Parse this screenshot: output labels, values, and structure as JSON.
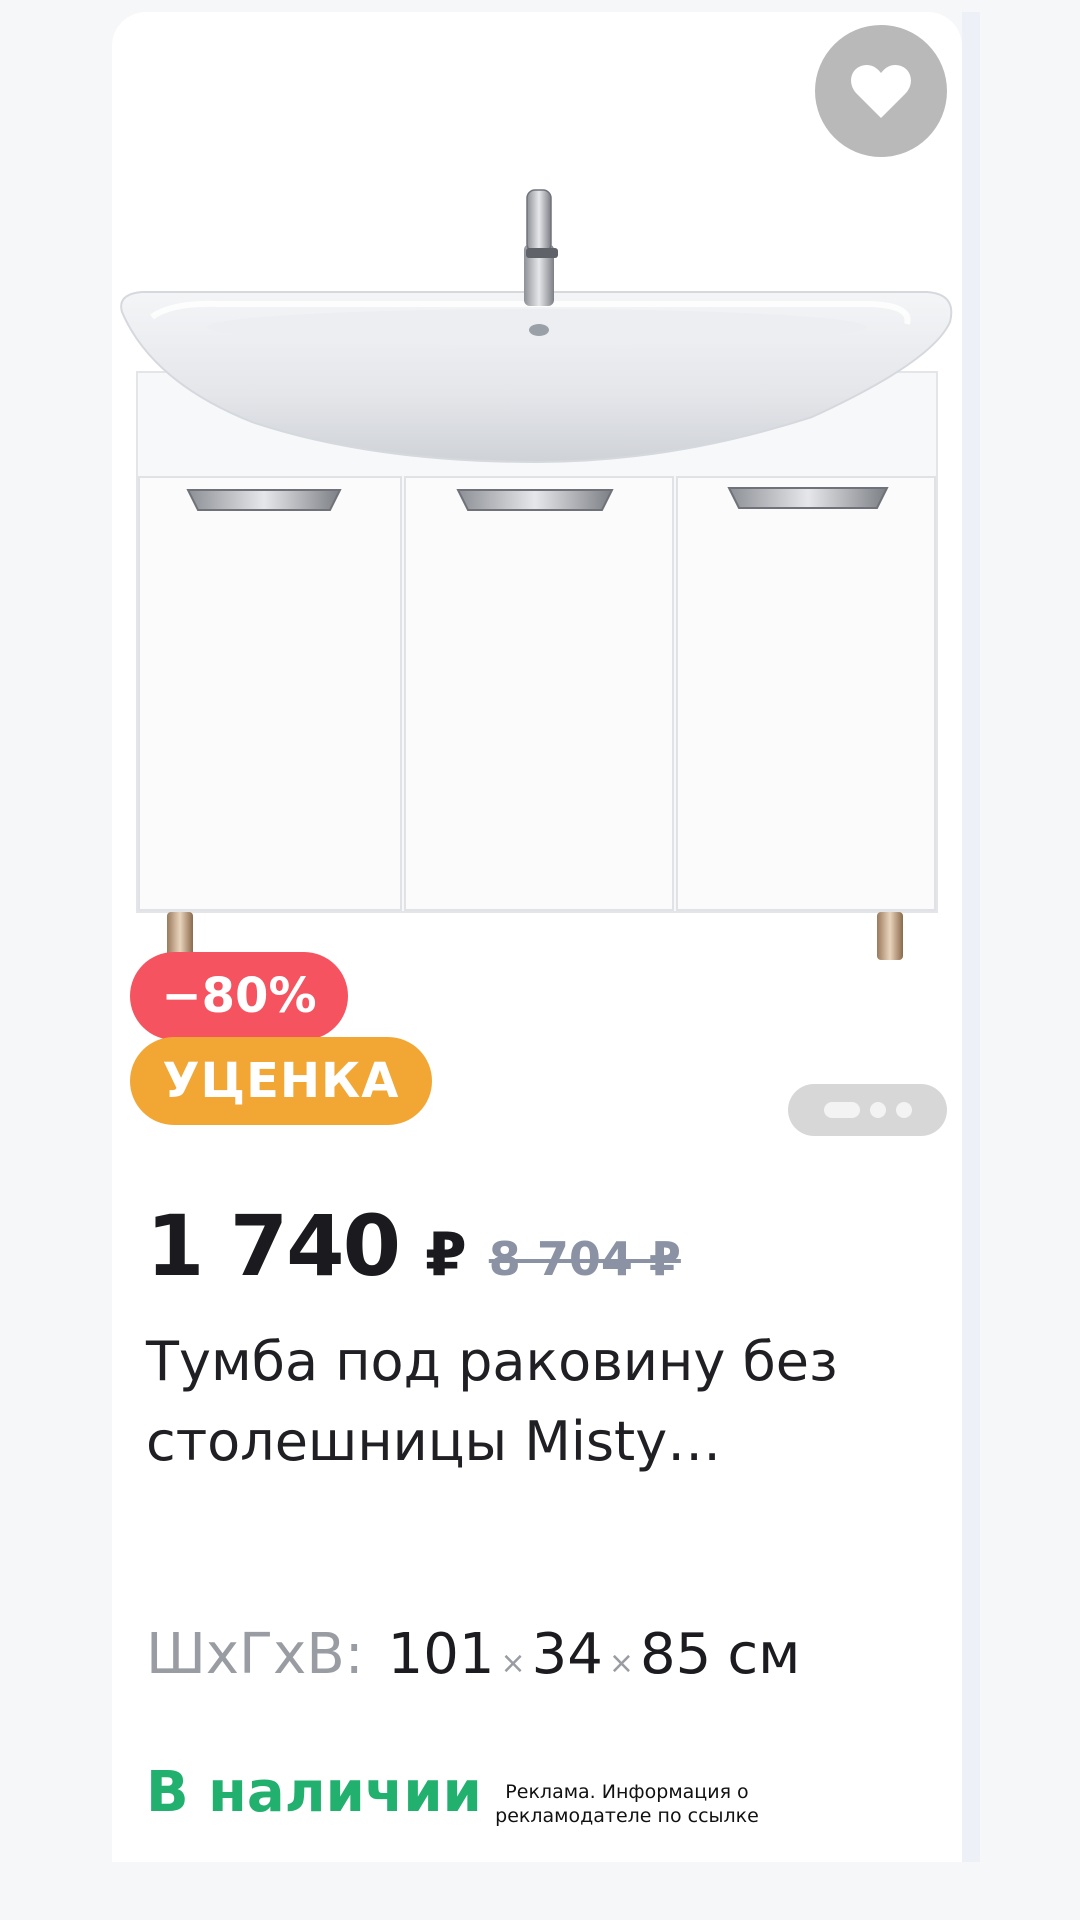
{
  "product": {
    "badges": {
      "discount": "−80%",
      "markdown": "УЦЕНКА"
    },
    "gallery": {
      "image_alt": "white-vanity-cabinet-with-sink",
      "slides": 3,
      "active_slide": 1
    },
    "price": {
      "current": "1 740",
      "currency": "₽",
      "old": "8 704 ₽"
    },
    "title": "Тумба под раковину без столешницы Misty…",
    "dimensions": {
      "label": "ШхГхВ:",
      "width": "101",
      "depth": "34",
      "height": "85",
      "separator": "×",
      "unit": "см"
    },
    "availability": "В наличии",
    "ad_note": "Реклама. Информация о рекламодателе по ссылке"
  },
  "icons": {
    "favorite": "heart-icon"
  },
  "colors": {
    "discount_badge": "#f5535f",
    "markdown_badge": "#f2a735",
    "in_stock": "#22b06f",
    "old_price": "#8a92a3"
  }
}
